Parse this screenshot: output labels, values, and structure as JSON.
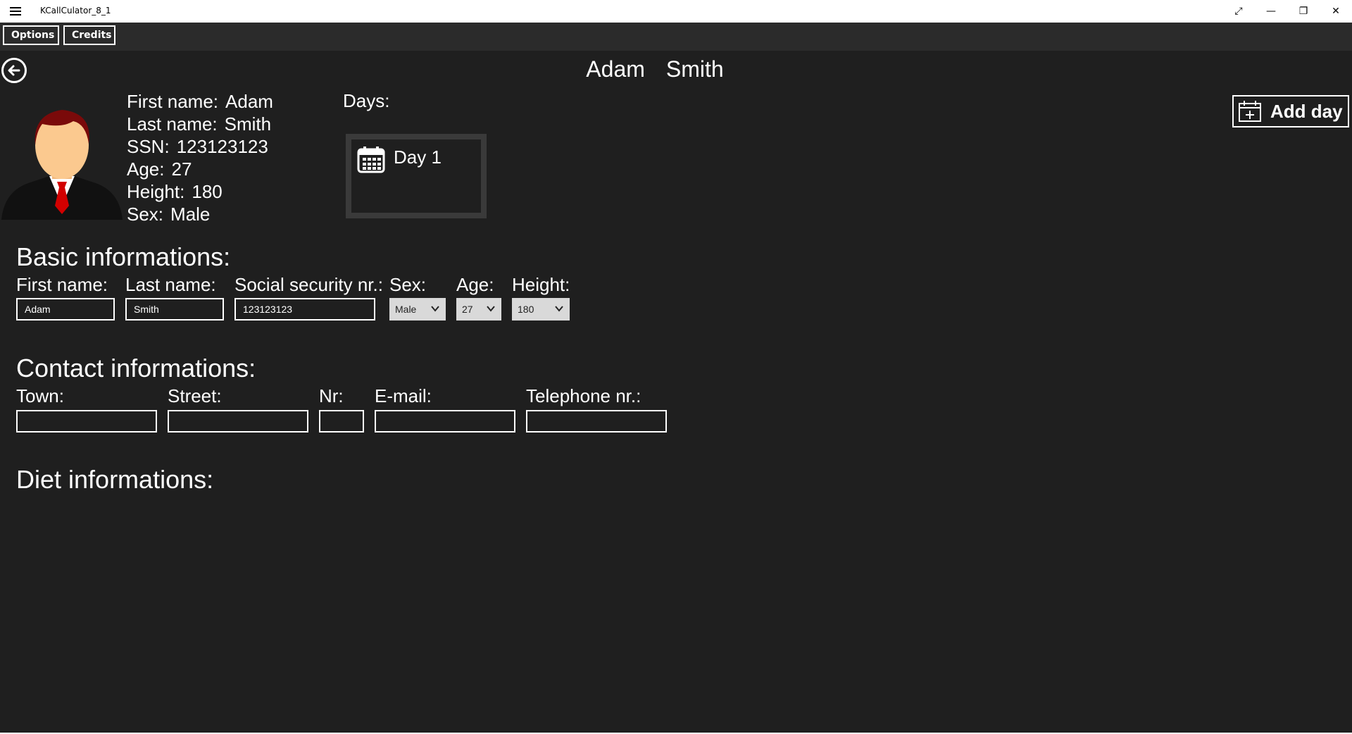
{
  "app": {
    "title": "KCallCulator_8_1"
  },
  "window_controls": {
    "fullscreen": "⤢",
    "minimize": "—",
    "restore": "❐",
    "close": "✕"
  },
  "toolbar": {
    "options_label": "Options",
    "credits_label": "Credits"
  },
  "header": {
    "first": "Adam",
    "last": "Smith"
  },
  "profile": {
    "first_name_label": "First name:",
    "first_name": "Adam",
    "last_name_label": "Last name:",
    "last_name": "Smith",
    "ssn_label": "SSN:",
    "ssn": "123123123",
    "age_label": "Age:",
    "age": "27",
    "height_label": "Height:",
    "height": "180",
    "sex_label": "Sex:",
    "sex": "Male"
  },
  "days": {
    "label": "Days:",
    "items": [
      {
        "label": "Day 1"
      }
    ],
    "add_label": "Add day"
  },
  "basic": {
    "title": "Basic informations:",
    "first_name_label": "First name:",
    "first_name_value": "Adam",
    "last_name_label": "Last name:",
    "last_name_value": "Smith",
    "ssn_label": "Social security nr.:",
    "ssn_value": "123123123",
    "sex_label": "Sex:",
    "sex_value": "Male",
    "age_label": "Age:",
    "age_value": "27",
    "height_label": "Height:",
    "height_value": "180"
  },
  "contact": {
    "title": "Contact informations:",
    "town_label": "Town:",
    "street_label": "Street:",
    "nr_label": "Nr:",
    "email_label": "E-mail:",
    "phone_label": "Telephone nr.:"
  },
  "diet": {
    "title": "Diet informations:"
  },
  "icons": {
    "back": "back-arrow-icon",
    "calendar": "calendar-icon",
    "avatar": "businessman-avatar-icon",
    "chevron": "chevron-down-icon"
  }
}
